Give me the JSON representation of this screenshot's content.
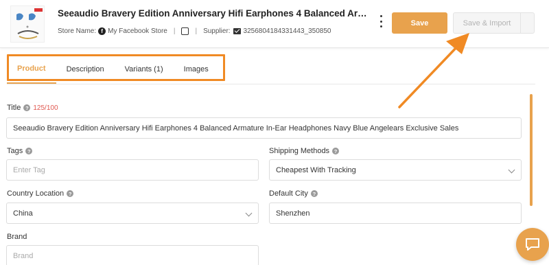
{
  "header": {
    "product_title": "Seeaudio Bravery Edition Anniversary Hifi Earphones 4 Balanced Armature In-Ear Headphones Navy Blue Angelears Exclusive Sales",
    "store_label": "Store Name:",
    "store_name": "My Facebook Store",
    "supplier_label": "Supplier:",
    "supplier_id": "3256804184331443_350850",
    "save_label": "Save",
    "save_import_label": "Save & Import",
    "accent_color": "#e8a24d"
  },
  "tabs": [
    {
      "label": "Product",
      "active": true
    },
    {
      "label": "Description",
      "active": false
    },
    {
      "label": "Variants (1)",
      "active": false
    },
    {
      "label": "Images",
      "active": false
    }
  ],
  "form": {
    "title_label": "Title",
    "title_count": "125/100",
    "title_value": "Seeaudio Bravery Edition Anniversary Hifi Earphones 4 Balanced Armature In-Ear Headphones Navy Blue Angelears Exclusive Sales",
    "tags_label": "Tags",
    "tags_placeholder": "Enter Tag",
    "shipping_label": "Shipping Methods",
    "shipping_value": "Cheapest With Tracking",
    "country_label": "Country Location",
    "country_value": "China",
    "city_label": "Default City",
    "city_value": "Shenzhen",
    "brand_label": "Brand",
    "brand_placeholder": "Brand"
  }
}
